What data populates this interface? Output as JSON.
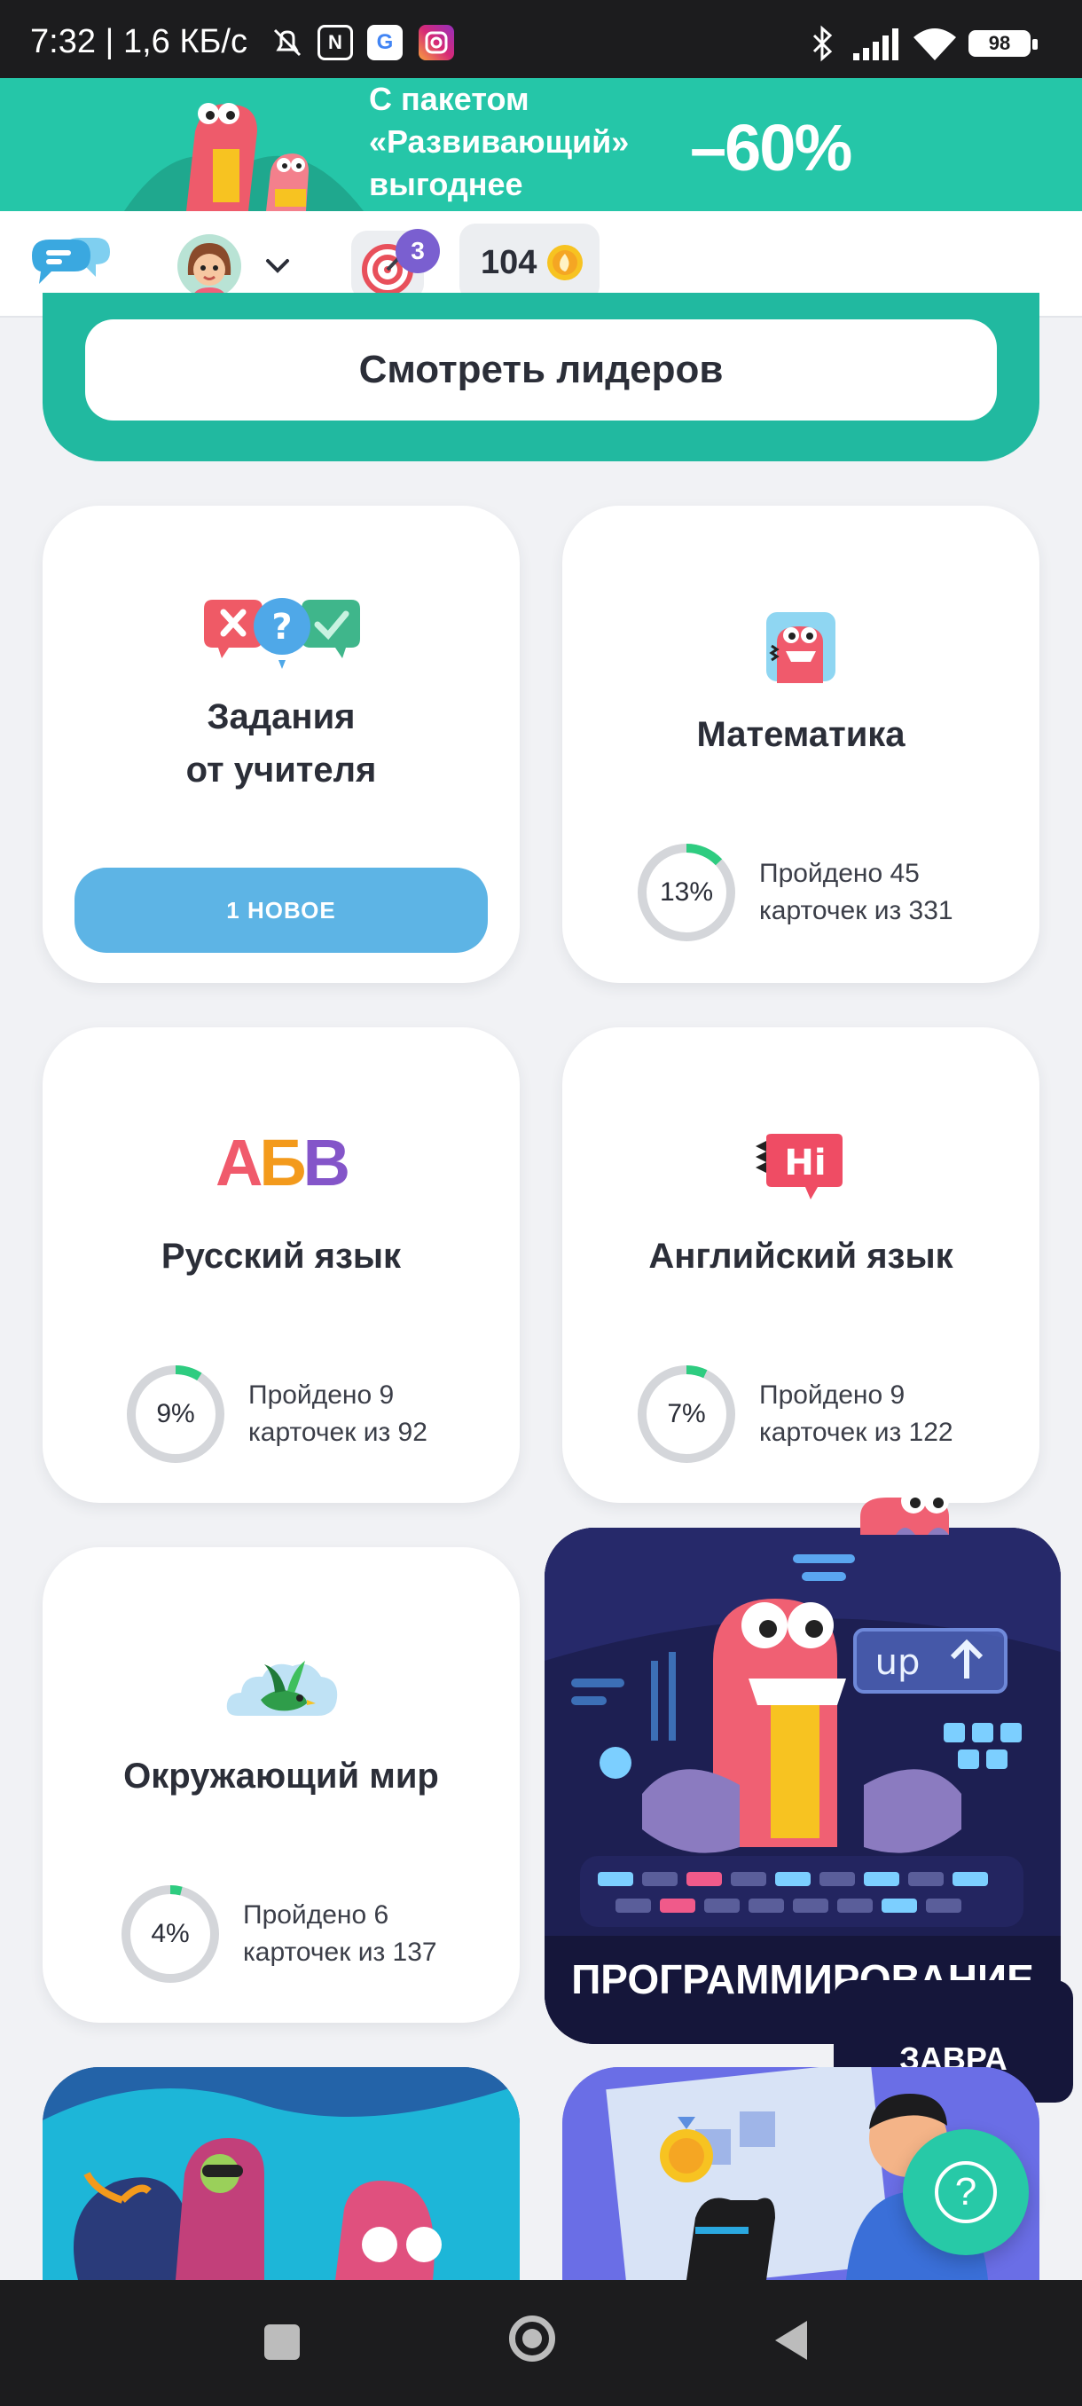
{
  "status_bar": {
    "time": "7:32 | 1,6 КБ/с",
    "battery": "98"
  },
  "promo": {
    "line1": "С пакетом",
    "line2": "«Развивающий»",
    "line3": "выгоднее",
    "discount": "–60%"
  },
  "topbar": {
    "target_badge": "3",
    "coins": "104"
  },
  "leaders": {
    "button_label": "Смотреть лидеров"
  },
  "cards": {
    "teacher": {
      "title_line1": "Задания",
      "title_line2": "от учителя",
      "button": "1 НОВОЕ"
    },
    "math": {
      "title": "Математика",
      "percent_label": "13%",
      "percent": 13,
      "line1": "Пройдено 45",
      "line2": "карточек из 331"
    },
    "russian": {
      "title": "Русский язык",
      "icon_text": "АБВ",
      "percent_label": "9%",
      "percent": 9,
      "line1": "Пройдено 9",
      "line2": "карточек из 92"
    },
    "english": {
      "title": "Английский язык",
      "icon_text": "Hi",
      "percent_label": "7%",
      "percent": 7,
      "line1": "Пройдено 9",
      "line2": "карточек из 122"
    },
    "world": {
      "title": "Окружающий мир",
      "percent_label": "4%",
      "percent": 4,
      "line1": "Пройдено 6",
      "line2": "карточек из 137"
    },
    "programming": {
      "title": "ПРОГРАММИРОВАНИЕ",
      "screen_text": "up"
    }
  },
  "floating": {
    "zavra": "ЗАВРА",
    "help": "?"
  },
  "colors": {
    "teal": "#25c6a8",
    "ring_track": "#d4d6da",
    "ring_progress": "#2ecc80",
    "blue_button": "#5db4e5",
    "prog_bg": "#15163a"
  }
}
